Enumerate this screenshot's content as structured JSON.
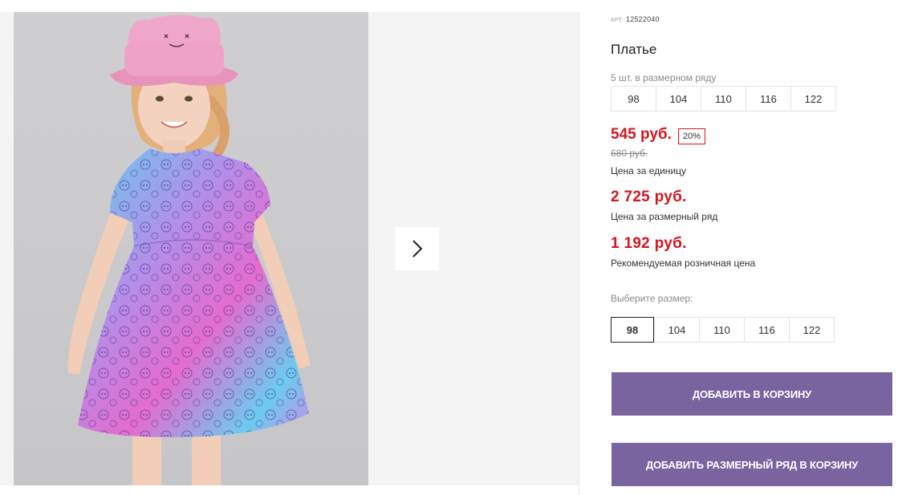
{
  "product": {
    "art_label": "АРТ:",
    "article": "12522040",
    "title": "Платье",
    "pack_label": "5 шт. в размерном ряду",
    "pack_sizes": [
      "98",
      "104",
      "110",
      "116",
      "122"
    ],
    "price": "545 руб.",
    "discount": "20%",
    "old_price": "680 руб.",
    "unit_price_caption": "Цена за единицу",
    "pack_price": "2 725 руб.",
    "pack_price_caption": "Цена за размерный ряд",
    "retail_price": "1 192 руб.",
    "retail_price_caption": "Рекомендуемая розничная цена",
    "choose_size_label": "Выберите размер:",
    "choose_sizes": [
      "98",
      "104",
      "110",
      "116",
      "122"
    ],
    "selected_size": "98"
  },
  "buttons": {
    "add_to_cart": "ДОБАВИТЬ В КОРЗИНУ",
    "add_pack_to_cart": "ДОБАВИТЬ РАЗМЕРНЫЙ РЯД В КОРЗИНУ"
  },
  "gallery": {
    "next_icon": "chevron-right-icon"
  },
  "colors": {
    "price_red": "#d4161f",
    "button_purple": "#7a64a0",
    "dress_pink": "#e76bd0",
    "dress_blue": "#57c8e8",
    "hat_pink": "#efa7c9"
  }
}
